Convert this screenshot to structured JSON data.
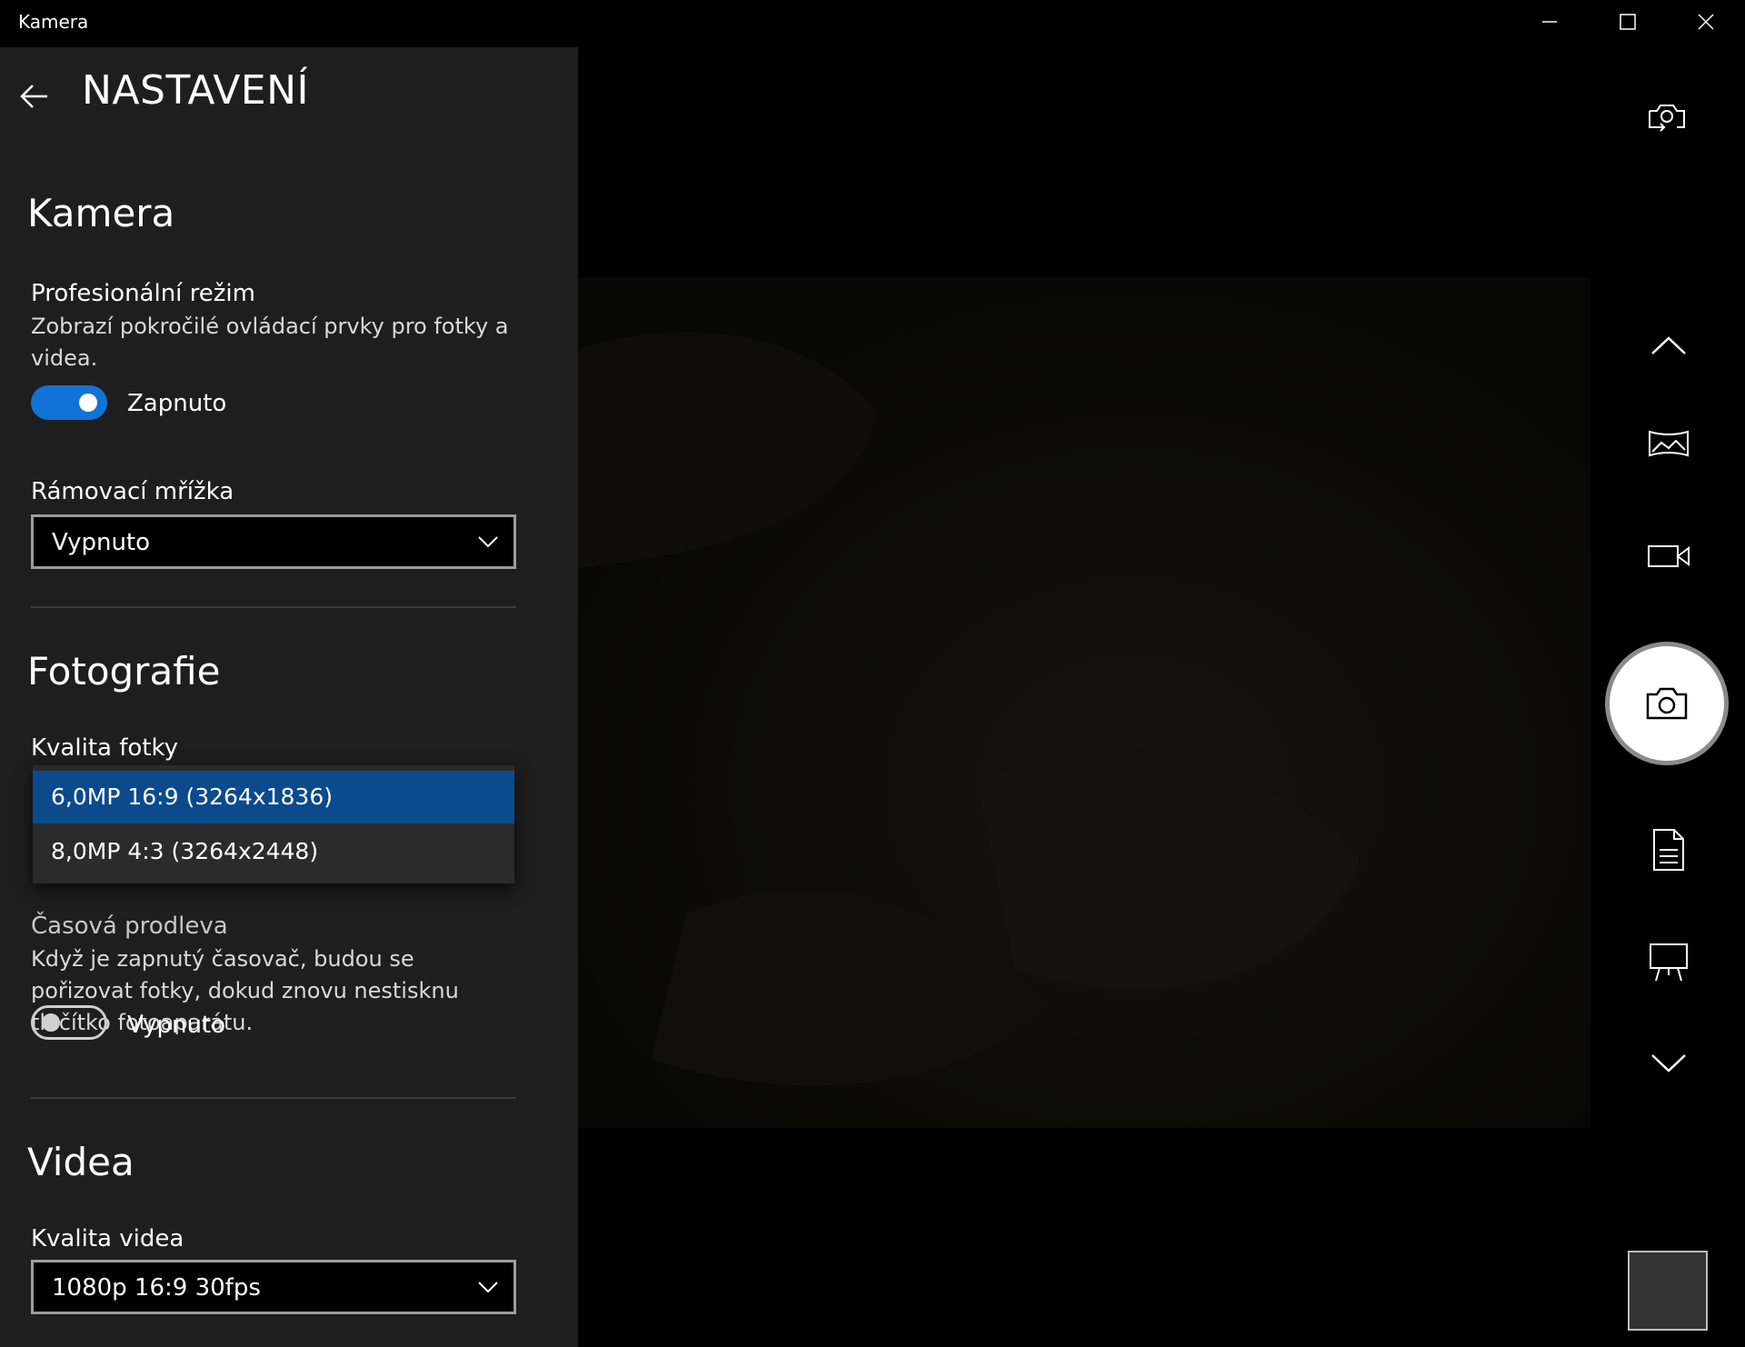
{
  "window": {
    "title": "Kamera"
  },
  "settings": {
    "title": "NASTAVENÍ",
    "camera_section": {
      "heading": "Kamera",
      "pro_mode": {
        "label": "Profesionální režim",
        "description": "Zobrazí pokročilé ovládací prvky pro fotky a videa.",
        "state_label": "Zapnuto",
        "on": true
      },
      "framing_grid": {
        "label": "Rámovací mřížka",
        "value": "Vypnuto"
      }
    },
    "photo_section": {
      "heading": "Fotografie",
      "quality": {
        "label": "Kvalita fotky",
        "options": [
          "6,0MP 16:9 (3264x1836)",
          "8,0MP 4:3 (3264x2448)"
        ],
        "selected_index": 0
      },
      "timelapse": {
        "label_partial": "Časová prodleva",
        "description": "Když je zapnutý časovač, budou se pořizovat fotky, dokud znovu nestisknu tlačítko fotoaparátu.",
        "state_label": "Vypnuto",
        "on": false
      }
    },
    "video_section": {
      "heading": "Videa",
      "quality": {
        "label": "Kvalita videa",
        "value": "1080p 16:9 30fps"
      }
    }
  },
  "rail": {
    "icons": [
      "switch-camera-icon",
      "chevron-up-icon",
      "panorama-icon",
      "video-icon",
      "camera-icon",
      "document-icon",
      "whiteboard-icon",
      "chevron-down-icon"
    ]
  },
  "colors": {
    "accent": "#1173d6",
    "selected_option": "#0b4a8c",
    "panel_bg": "#1e1e1e"
  }
}
